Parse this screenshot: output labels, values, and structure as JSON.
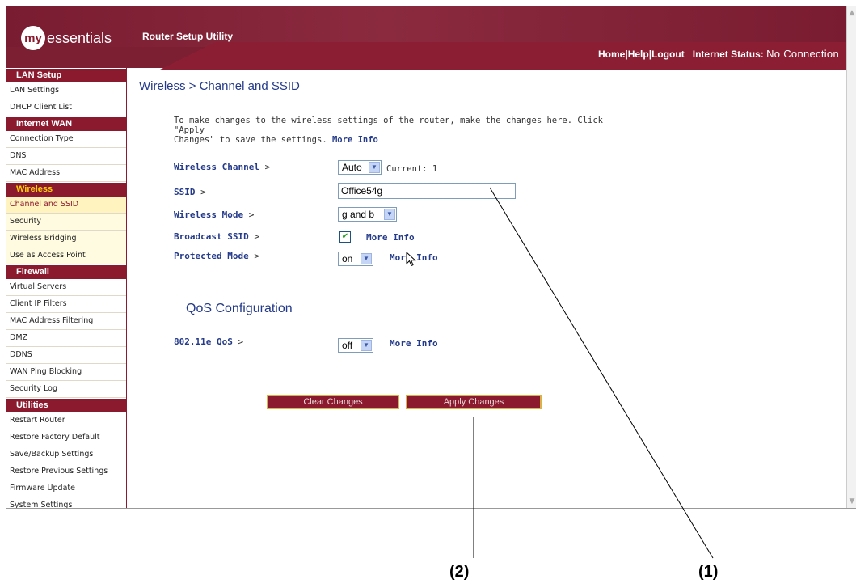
{
  "header": {
    "logo_my": "my",
    "logo_rest": "essentials",
    "app_title": "Router Setup Utility",
    "links": [
      "Home",
      "Help",
      "Logout"
    ],
    "status_label": "Internet Status:",
    "status_value": "No Connection"
  },
  "sidebar": {
    "sections": [
      {
        "title": "LAN Setup",
        "items": [
          "LAN Settings",
          "DHCP Client List"
        ]
      },
      {
        "title": "Internet WAN",
        "items": [
          "Connection Type",
          "DNS",
          "MAC Address"
        ]
      },
      {
        "title": "Wireless",
        "items": [
          "Channel and SSID",
          "Security",
          "Wireless Bridging",
          "Use as Access Point"
        ]
      },
      {
        "title": "Firewall",
        "items": [
          "Virtual Servers",
          "Client IP Filters",
          "MAC Address Filtering",
          "DMZ",
          "DDNS",
          "WAN Ping Blocking",
          "Security Log"
        ]
      },
      {
        "title": "Utilities",
        "items": [
          "Restart Router",
          "Restore Factory Default",
          "Save/Backup Settings",
          "Restore Previous Settings",
          "Firmware Update",
          "System Settings"
        ]
      }
    ]
  },
  "main": {
    "title": "Wireless > Channel and SSID",
    "desc_line1": "To make changes to the wireless settings of the router, make the changes here. Click \"Apply",
    "desc_line2": "Changes\" to save the settings.",
    "more_info": "More Info",
    "fields": {
      "channel_label": "Wireless Channel",
      "channel_value": "Auto",
      "channel_current": "Current: 1",
      "ssid_label": "SSID",
      "ssid_value": "Office54g",
      "mode_label": "Wireless Mode",
      "mode_value": "g and b",
      "broadcast_label": "Broadcast SSID",
      "broadcast_checked": "✔",
      "protected_label": "Protected Mode",
      "protected_value": "on",
      "gt": ">"
    },
    "qos_title": "QoS Configuration",
    "qos_label": "802.11e QoS",
    "qos_value": "off",
    "clear_button": "Clear Changes",
    "apply_button": "Apply Changes"
  },
  "callouts": {
    "one": "(1)",
    "two": "(2)"
  },
  "colors": {
    "brand": "#8b1a2f",
    "link": "#243a8a",
    "highlight": "#ffd200"
  }
}
